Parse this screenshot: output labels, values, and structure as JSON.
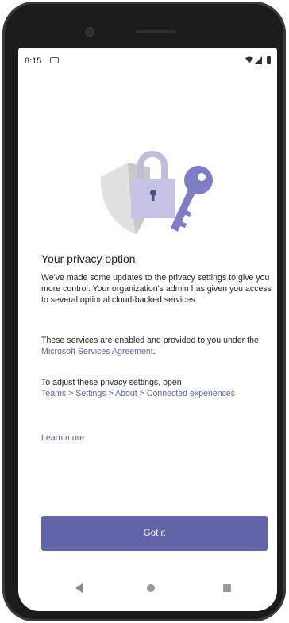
{
  "status_bar": {
    "time": "8:15",
    "notification_icon": "notification-icon",
    "wifi_icon": "wifi-icon",
    "signal_icon": "signal-icon",
    "battery_icon": "battery-icon"
  },
  "illustration": {
    "icons": [
      "shield-icon",
      "padlock-icon",
      "key-icon"
    ]
  },
  "content": {
    "title": "Your privacy option",
    "paragraph1": "We've made some updates to the privacy settings to give you more control. Your organization's admin has given you access to several optional cloud-backed services.",
    "paragraph2_prefix": "These services are enabled and provided to you under the ",
    "paragraph2_link": "Microsoft Services Agreement",
    "paragraph2_suffix": ".",
    "paragraph3_prefix": "To adjust these privacy settings, open",
    "paragraph3_path": "Teams > Settings > About > Connected experiences",
    "learn_more": "Learn more"
  },
  "actions": {
    "got_it": "Got it"
  },
  "nav_bar": {
    "back_icon": "back-icon",
    "home_icon": "home-icon",
    "recents_icon": "recents-icon"
  },
  "colors": {
    "accent": "#6264a7",
    "text": "#242424"
  }
}
